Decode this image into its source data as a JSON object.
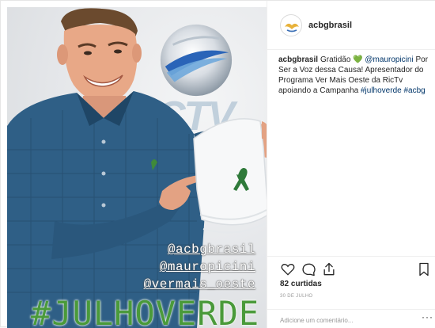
{
  "photo": {
    "overlay_handles": [
      "@acbgbrasil",
      "@mauropicini",
      "@vermais_oeste"
    ],
    "overlay_hashtag": "#JULHOVERDE",
    "background_text": "CTV"
  },
  "post": {
    "username": "acbgbrasil",
    "caption": {
      "author": "acbgbrasil",
      "text_1": "Gratidão",
      "heart": "💚",
      "mention": "@mauropicini",
      "text_2": "Por Ser a Voz dessa Causa! Apresentador do Programa Ver Mais Oeste da RicTv apoiando a Campanha",
      "hashtag_1": "#julhoverde",
      "hashtag_2": "#acbg"
    },
    "likes": "82 curtidas",
    "date": "30 DE JULHO",
    "comment_placeholder": "Adicione um comentário...",
    "more_label": "···"
  },
  "colors": {
    "accent_green": "#4a9a3a",
    "link_blue": "#003569",
    "shirt_blue": "#2f5f86"
  },
  "icons": [
    "heart-icon",
    "comment-icon",
    "share-icon",
    "bookmark-icon",
    "options-icon"
  ]
}
